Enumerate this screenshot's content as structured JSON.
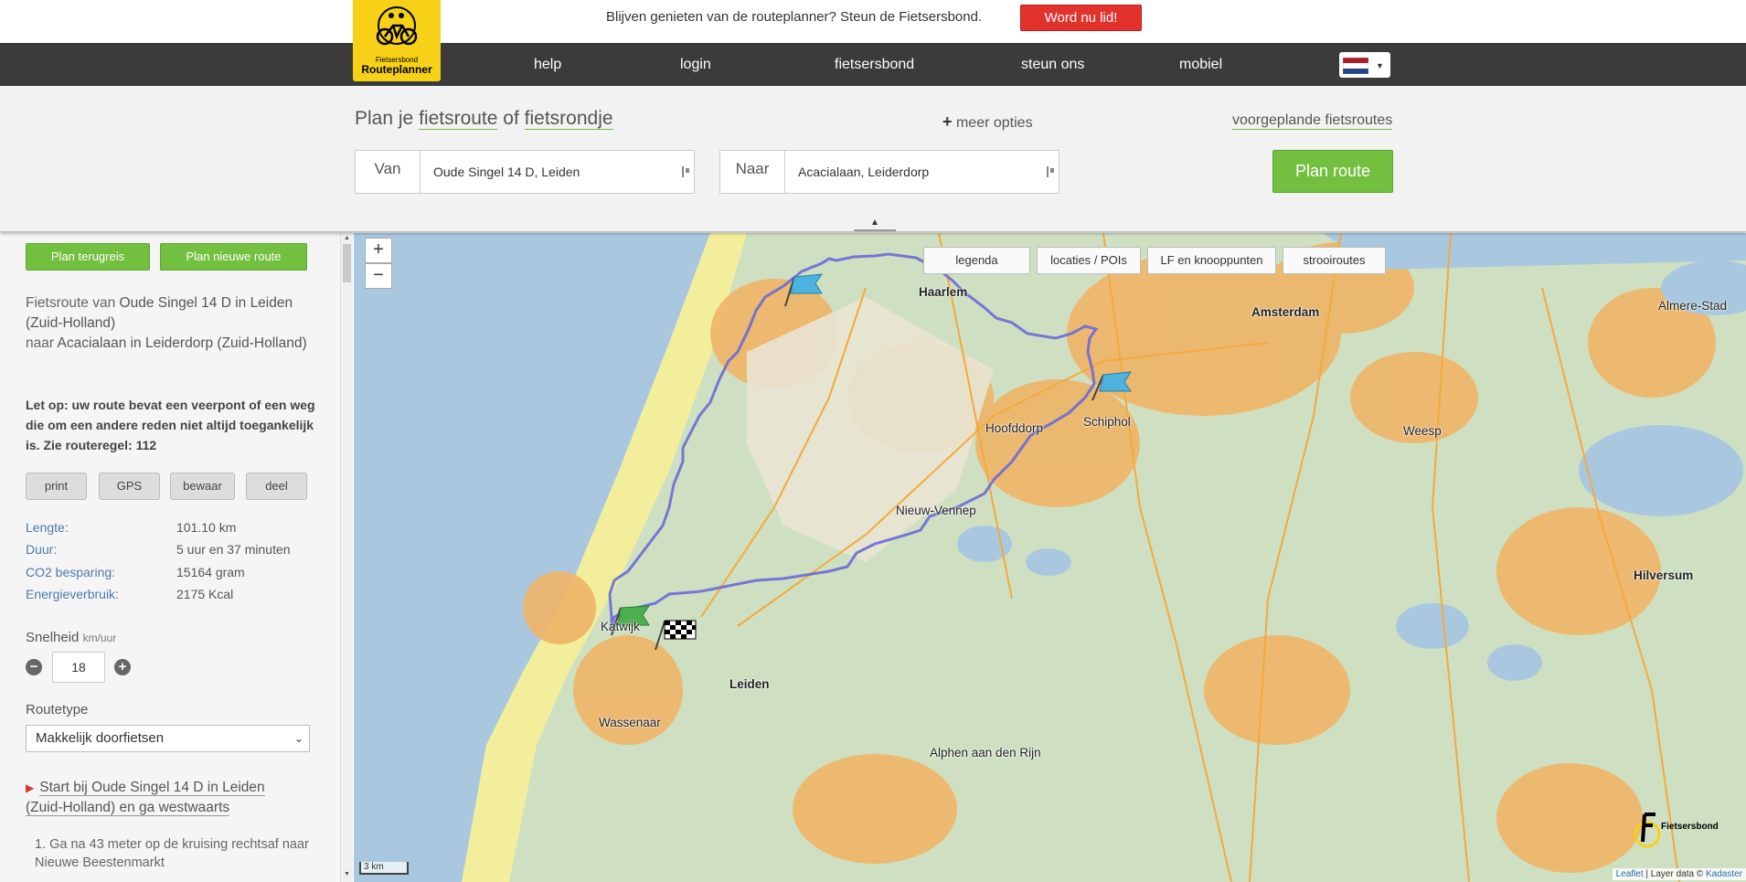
{
  "banner": {
    "logo_line1": "Fietsersbond",
    "logo_line2": "Routeplanner",
    "promo_text": "Blijven genieten van de routeplanner? Steun de Fietsersbond.",
    "join_label": "Word nu lid!"
  },
  "nav": {
    "items": [
      "help",
      "login",
      "fietsersbond",
      "steun ons",
      "mobiel"
    ],
    "language_flag": "nl-flag-icon"
  },
  "planner": {
    "title_prefix": "Plan je",
    "title_link1": "fietsroute",
    "title_mid": "of",
    "title_link2": "fietsrondje",
    "more_options": "meer opties",
    "preset_link": "voorgeplande fietsroutes",
    "from_label": "Van",
    "from_value": "Oude Singel 14 D, Leiden",
    "to_label": "Naar",
    "to_value": "Acacialaan, Leiderdorp",
    "plan_button": "Plan route"
  },
  "sidebar": {
    "return_button": "Plan terugreis",
    "new_button": "Plan nieuwe route",
    "desc_prefix": "Fietsroute van",
    "desc_from": "Oude Singel 14 D in Leiden (Zuid-Holland)",
    "desc_mid": "naar",
    "desc_to": "Acacialaan in Leiderdorp (Zuid-Holland)",
    "warning": "Let op: uw route bevat een veerpont of een weg die om een andere reden niet altijd toegankelijk is. Zie routeregel: 112",
    "actions": [
      "print",
      "GPS",
      "bewaar",
      "deel"
    ],
    "stats": {
      "length_label": "Lengte:",
      "length_value": "101.10 km",
      "duration_label": "Duur:",
      "duration_value": "5 uur en 37 minuten",
      "co2_label": "CO2 besparing:",
      "co2_value": "15164  gram",
      "energy_label": "Energieverbruik:",
      "energy_value": "2175 Kcal"
    },
    "speed_label": "Snelheid",
    "speed_unit": "km/uur",
    "speed_value": "18",
    "routetype_label": "Routetype",
    "routetype_value": "Makkelijk doorfietsen",
    "start_instruction": "Start bij Oude Singel 14 D in Leiden (Zuid-Holland) en ga westwaarts",
    "step1": "1. Ga na 43 meter op de kruising rechtsaf naar Nieuwe Beestenmarkt"
  },
  "map": {
    "buttons": [
      "legenda",
      "locaties / POIs",
      "LF en knooppunten",
      "strooiroutes"
    ],
    "places": {
      "haarlem": "Haarlem",
      "amsterdam": "Amsterdam",
      "almere": "Almere-Stad",
      "hoofddorp": "Hoofddorp",
      "schiphol": "Schiphol",
      "weesp": "Weesp",
      "nieuw_vennep": "Nieuw-Vennep",
      "katwijk": "Katwijk",
      "leiden": "Leiden",
      "wassenaar": "Wassenaar",
      "alphen": "Alphen aan den Rijn",
      "hilversum": "Hilversum"
    },
    "scale": "3 km",
    "attribution_leaflet": "Leaflet",
    "attribution_text": "| Layer data ©",
    "attribution_kadaster": "Kadaster",
    "watermark": "Fietsersbond",
    "route_color": "#6a6ad8"
  }
}
